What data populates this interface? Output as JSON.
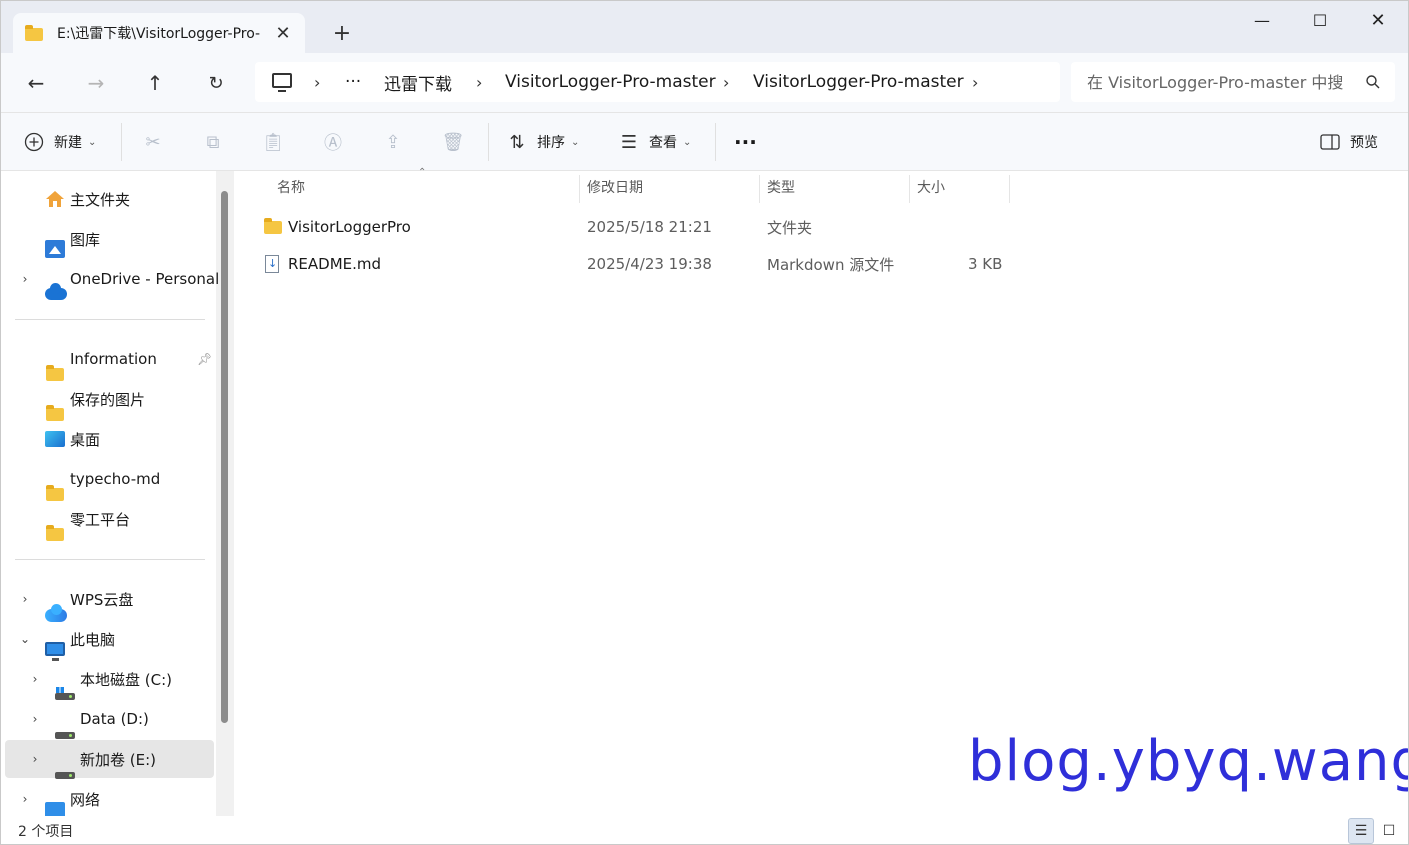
{
  "window": {
    "tab_title": "E:\\迅雷下载\\VisitorLogger-Pro-",
    "tab_close": "✕",
    "new_tab": "+",
    "minimize": "—",
    "maximize": "☐",
    "close": "✕"
  },
  "nav": {
    "back_icon": "←",
    "forward_icon": "→",
    "up_icon": "↑",
    "refresh_icon": "↻"
  },
  "address": {
    "overflow": "···",
    "crumbs": [
      "迅雷下载",
      "VisitorLogger-Pro-master",
      "VisitorLogger-Pro-master"
    ],
    "separator": "›"
  },
  "search": {
    "placeholder": "在 VisitorLogger-Pro-master 中搜"
  },
  "commandbar": {
    "new_label": "新建",
    "sort_label": "排序",
    "view_label": "查看",
    "more": "···",
    "preview_label": "预览"
  },
  "sidebar": {
    "items": [
      {
        "label": "主文件夹",
        "icon": "home-icon"
      },
      {
        "label": "图库",
        "icon": "gallery-icon"
      },
      {
        "label": "OneDrive - Personal",
        "icon": "onedrive-icon"
      },
      {
        "label": "Information",
        "icon": "folder-icon",
        "pinned": true
      },
      {
        "label": "保存的图片",
        "icon": "folder-icon"
      },
      {
        "label": "桌面",
        "icon": "desktop-icon"
      },
      {
        "label": "typecho-md",
        "icon": "folder-icon"
      },
      {
        "label": "零工平台",
        "icon": "folder-icon"
      },
      {
        "label": "WPS云盘",
        "icon": "wps-cloud-icon"
      },
      {
        "label": "此电脑",
        "icon": "pc-icon"
      },
      {
        "label": "本地磁盘 (C:)",
        "icon": "system-drive-icon"
      },
      {
        "label": "Data (D:)",
        "icon": "drive-icon"
      },
      {
        "label": "新加卷 (E:)",
        "icon": "drive-icon",
        "selected": true
      },
      {
        "label": "网络",
        "icon": "network-icon"
      }
    ]
  },
  "filelist": {
    "columns": [
      "名称",
      "修改日期",
      "类型",
      "大小"
    ],
    "rows": [
      {
        "name": "VisitorLoggerPro",
        "modified": "2025/5/18 21:21",
        "type": "文件夹",
        "size": "",
        "icon": "folder-icon"
      },
      {
        "name": "README.md",
        "modified": "2025/4/23 19:38",
        "type": "Markdown 源文件",
        "size": "3 KB",
        "icon": "markdown-file-icon"
      }
    ]
  },
  "watermark": "blog.ybyq.wang",
  "status": {
    "item_count": "2 个项目"
  },
  "colors": {
    "accent": "#2f2fd9",
    "folder": "#f5c642",
    "chrome_bg": "#f7f9fc"
  }
}
